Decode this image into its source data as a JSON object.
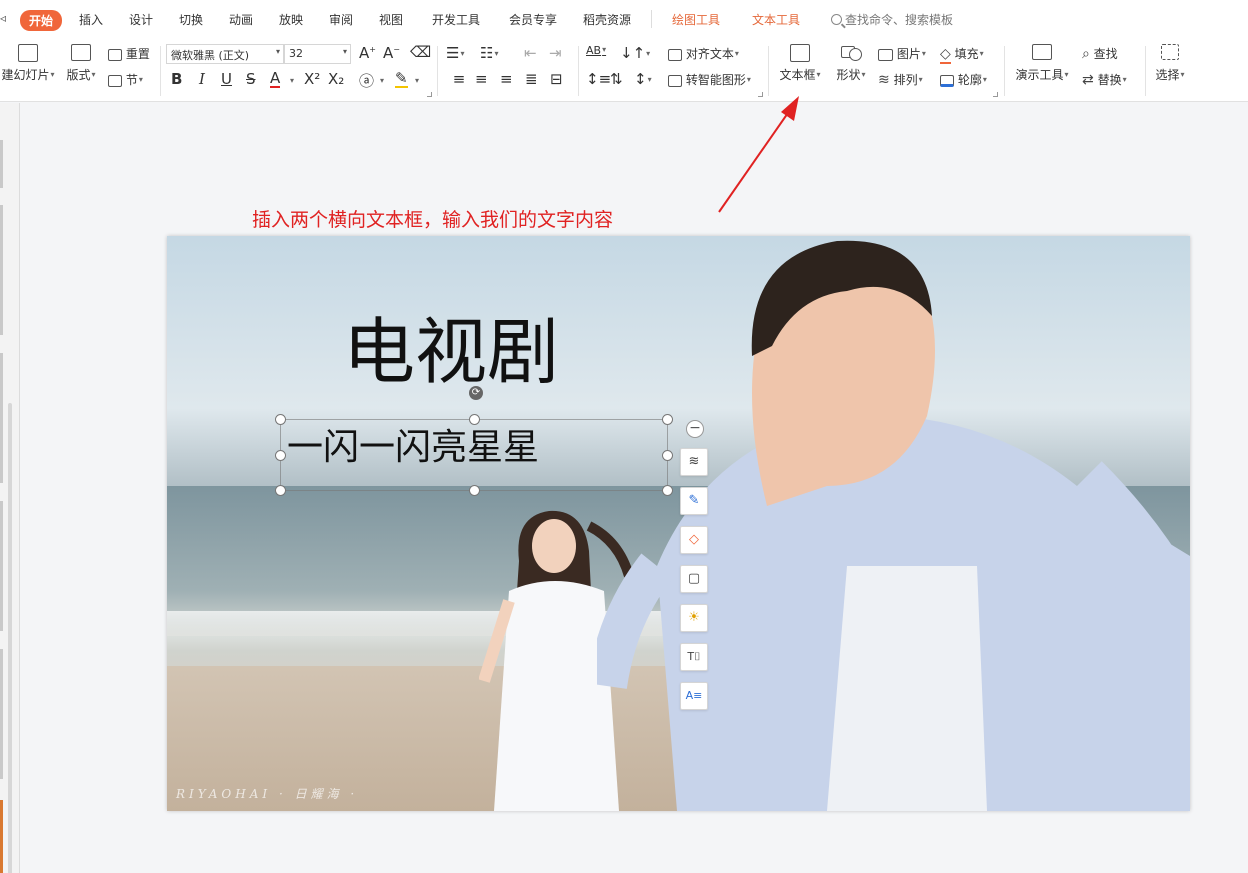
{
  "menu": {
    "tabs": [
      {
        "label": "开始",
        "active": true
      },
      {
        "label": "插入"
      },
      {
        "label": "设计"
      },
      {
        "label": "切换"
      },
      {
        "label": "动画"
      },
      {
        "label": "放映"
      },
      {
        "label": "审阅"
      },
      {
        "label": "视图"
      },
      {
        "label": "开发工具"
      },
      {
        "label": "会员专享"
      },
      {
        "label": "稻壳资源"
      },
      {
        "label": "绘图工具",
        "contextual": true
      },
      {
        "label": "文本工具",
        "contextual": true
      }
    ],
    "search_placeholder": "查找命令、搜索模板"
  },
  "ribbon": {
    "new_slide": "建幻灯片",
    "layout": "版式",
    "reset": "重置",
    "section": "节",
    "font_name": "微软雅黑 (正文)",
    "font_size": "32",
    "align_text": "对齐文本",
    "smartart": "转智能图形",
    "textbox": "文本框",
    "shape": "形状",
    "picture": "图片",
    "arrange": "排列",
    "fill": "填充",
    "outline": "轮廓",
    "present_tools": "演示工具",
    "find": "查找",
    "replace": "替换",
    "select": "选择"
  },
  "annotation": {
    "text": "插入两个横向文本框，输入我们的文字内容",
    "color": "#e02222"
  },
  "slide": {
    "title": "电视剧",
    "subtitle": "一闪一闪亮星星",
    "watermark": "RIYAOHAI · 日耀海 ·"
  },
  "floatbar": [
    "minus-icon",
    "layers-icon",
    "brush-icon",
    "fill-icon",
    "outline-icon",
    "bulb-icon",
    "text-transform-icon",
    "text-style-icon"
  ],
  "colors": {
    "accent": "#f0663a",
    "context_tab": "#e5683a",
    "annotation": "#e02222"
  }
}
